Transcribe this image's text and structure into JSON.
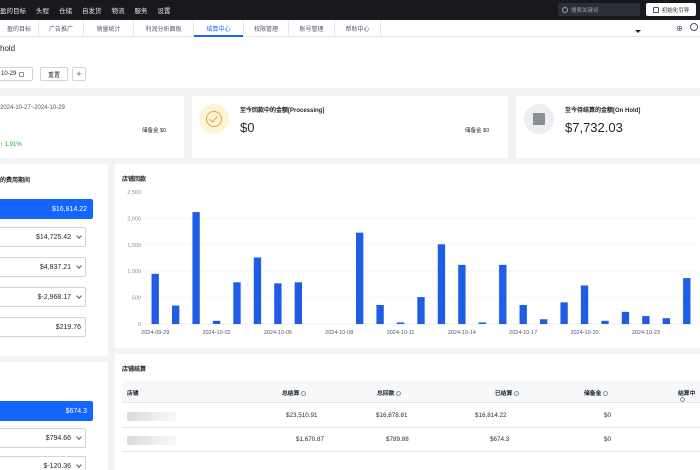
{
  "topnav": {
    "items": [
      "盈的目标",
      "头程",
      "仓储",
      "自发货",
      "物流",
      "服务",
      "设置"
    ],
    "search_placeholder": "搜索关键词",
    "guide_label": "初始化引导"
  },
  "tabs": [
    {
      "label": "盈的目标"
    },
    {
      "label": "广告推广"
    },
    {
      "label": "销量统计"
    },
    {
      "label": "利润分析面板"
    },
    {
      "label": "结算中心",
      "active": true
    },
    {
      "label": "权限管理"
    },
    {
      "label": "账号管理"
    },
    {
      "label": "帮助中心"
    }
  ],
  "page": {
    "title": "hold",
    "date_value": "10-29",
    "reset_label": "重置"
  },
  "summary": {
    "range": "2024-10-27~2024-10-29",
    "card1_reserve": "储备金 $0",
    "card1_growth": "↑ 1.91%",
    "processing_label": "至今回款中的金额[Processing]",
    "processing_value": "$0",
    "processing_reserve": "储备金 $0",
    "onhold_label": "至今待结算的金额[On Hold]",
    "onhold_value": "$7,732.03"
  },
  "left_panel": {
    "title": "的费用期间",
    "selected": "$16,814.22",
    "rows": [
      "$14,725.42",
      "$4,837.21",
      "$-2,968.17",
      "$219.76"
    ]
  },
  "left_panel2": {
    "selected": "$674.3",
    "rows": [
      "$794.66",
      "$-120.36"
    ]
  },
  "chart_panel": {
    "title": "店铺回款"
  },
  "chart_data": {
    "type": "bar",
    "title": "店铺回款",
    "x_tick_labels": [
      "2024-09-29",
      "2024-10-02",
      "2024-10-05",
      "2024-10-08",
      "2024-10-11",
      "2024-10-14",
      "2024-10-17",
      "2024-10-20",
      "2024-10-23"
    ],
    "ylim": [
      0,
      2500
    ],
    "yticks": [
      "0",
      "500",
      "1,000",
      "1,500",
      "2,000",
      "2,500"
    ],
    "values": [
      950,
      350,
      2120,
      60,
      790,
      1260,
      770,
      790,
      0,
      0,
      1730,
      360,
      30,
      510,
      1510,
      1120,
      30,
      1120,
      360,
      90,
      410,
      730,
      60,
      230,
      150,
      110,
      870
    ],
    "color": "#1e5ee6",
    "grid": true
  },
  "table": {
    "title": "店铺结算",
    "headers": [
      "店铺",
      "总结算",
      "总回款",
      "已结算",
      "储备金",
      "结算中"
    ],
    "rows": [
      {
        "total_settle": "$23,510.91",
        "total_return": "$16,878.81",
        "settled": "$16,814.22",
        "reserve": "$0"
      },
      {
        "total_settle": "$1,670.87",
        "total_return": "$789.88",
        "settled": "$674.3",
        "reserve": "$0"
      }
    ]
  }
}
